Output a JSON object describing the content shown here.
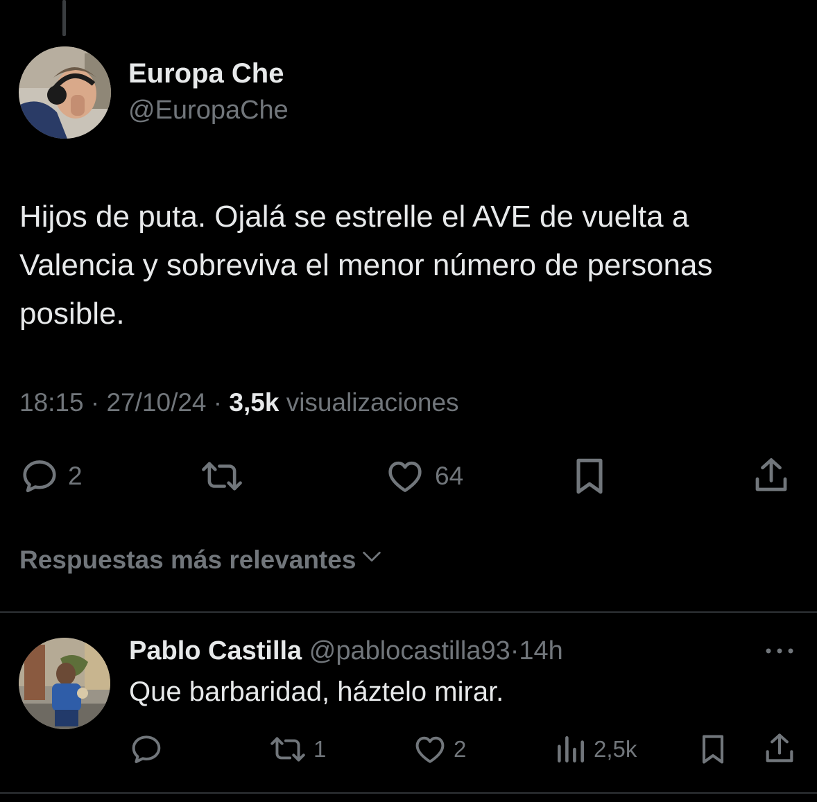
{
  "tweet": {
    "author_name": "Europa Che",
    "author_handle": "@EuropaChe",
    "text": "Hijos de puta. Ojalá se estrelle el AVE de vuelta a Valencia y sobreviva el menor número de personas posible.",
    "time": "18:15",
    "separator": "·",
    "date": "27/10/24",
    "views_count": "3,5k",
    "views_label": "visualizaciones",
    "actions": {
      "reply_count": "2",
      "retweet_count": "",
      "like_count": "64"
    }
  },
  "replies_sort": {
    "label": "Respuestas más relevantes"
  },
  "reply": {
    "author_name": "Pablo Castilla",
    "author_handle": "@pablocastilla93",
    "separator": "·",
    "time": "14h",
    "text": "Que barbaridad, háztelo mirar.",
    "actions": {
      "reply_count": "",
      "retweet_count": "1",
      "like_count": "2",
      "views_count": "2,5k"
    }
  },
  "icons": {
    "reply": "speech-bubble-icon",
    "retweet": "retweet-arrows-icon",
    "like": "heart-icon",
    "bookmark": "bookmark-icon",
    "share": "share-upload-icon",
    "views": "bar-chart-icon",
    "more": "ellipsis-icon",
    "sort": "chevron-down-icon"
  },
  "colors": {
    "background": "#000000",
    "primary_text": "#e7e9ea",
    "secondary_text": "#71767b",
    "divider": "#2f3336"
  }
}
